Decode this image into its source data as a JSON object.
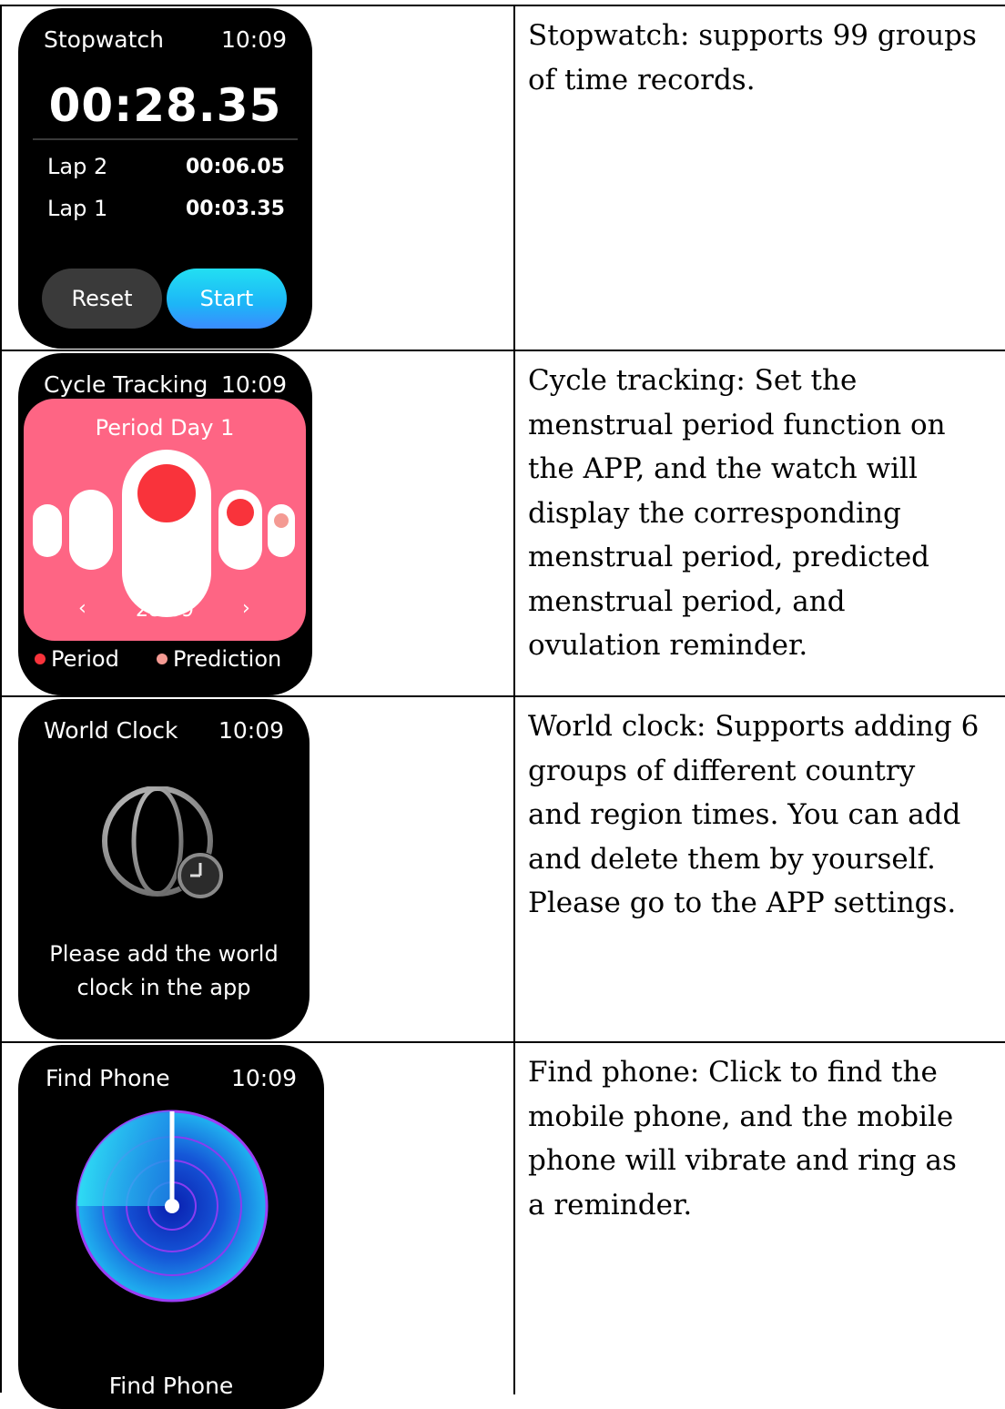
{
  "rows": [
    {
      "description": "Stopwatch: supports 99 groups\nof time records.",
      "watch": {
        "title": "Stopwatch",
        "time": "10:09",
        "elapsed": "00:28.35",
        "laps": [
          {
            "label": "Lap 2",
            "value": "00:06.05"
          },
          {
            "label": "Lap 1",
            "value": "00:03.35"
          }
        ],
        "reset_label": "Reset",
        "start_label": "Start"
      }
    },
    {
      "description": "Cycle tracking: Set the\nmenstrual period function on\nthe APP, and the watch will\ndisplay the corresponding\nmenstrual period, predicted\nmenstrual period, and\novulation reminder.",
      "watch": {
        "title": "Cycle Tracking",
        "time": "10:09",
        "day_label": "Period Day 1",
        "date": "28-09",
        "legend_period": "Period",
        "legend_prediction": "Prediction",
        "colors": {
          "panel": "#fe6584",
          "period": "#f9333b",
          "prediction": "#f49a93"
        }
      }
    },
    {
      "description": "World clock: Supports adding 6\ngroups of different country\nand region times. You can add\nand delete them by yourself.\nPlease go to the APP settings.",
      "watch": {
        "title": "World Clock",
        "time": "10:09",
        "message_line1": "Please add the world",
        "message_line2": "clock in the app"
      }
    },
    {
      "description": "Find phone: Click to find the\nmobile phone, and the mobile\nphone will vibrate and ring as\na reminder.",
      "watch": {
        "title": "Find Phone",
        "time": "10:09",
        "label": "Find Phone"
      }
    }
  ]
}
